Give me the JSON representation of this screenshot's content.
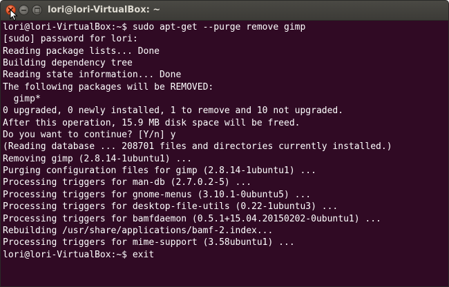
{
  "window": {
    "title": "lori@lori-VirtualBox: ~",
    "buttons": {
      "close": "close-icon",
      "minimize": "minimize-icon",
      "maximize": "maximize-icon"
    }
  },
  "colors": {
    "terminal_background": "#300a24",
    "terminal_text": "#ffffff",
    "titlebar": "#3c3b37",
    "close_button": "#e7572b"
  },
  "terminal": {
    "lines": [
      "lori@lori-VirtualBox:~$ sudo apt-get --purge remove gimp",
      "[sudo] password for lori:",
      "Reading package lists... Done",
      "Building dependency tree",
      "Reading state information... Done",
      "The following packages will be REMOVED:",
      "  gimp*",
      "0 upgraded, 0 newly installed, 1 to remove and 10 not upgraded.",
      "After this operation, 15.9 MB disk space will be freed.",
      "Do you want to continue? [Y/n] y",
      "(Reading database ... 208701 files and directories currently installed.)",
      "Removing gimp (2.8.14-1ubuntu1) ...",
      "Purging configuration files for gimp (2.8.14-1ubuntu1) ...",
      "Processing triggers for man-db (2.7.0.2-5) ...",
      "Processing triggers for gnome-menus (3.10.1-0ubuntu5) ...",
      "Processing triggers for desktop-file-utils (0.22-1ubuntu3) ...",
      "Processing triggers for bamfdaemon (0.5.1+15.04.20150202-0ubuntu1) ...",
      "Rebuilding /usr/share/applications/bamf-2.index...",
      "Processing triggers for mime-support (3.58ubuntu1) ...",
      "lori@lori-VirtualBox:~$ exit"
    ]
  }
}
